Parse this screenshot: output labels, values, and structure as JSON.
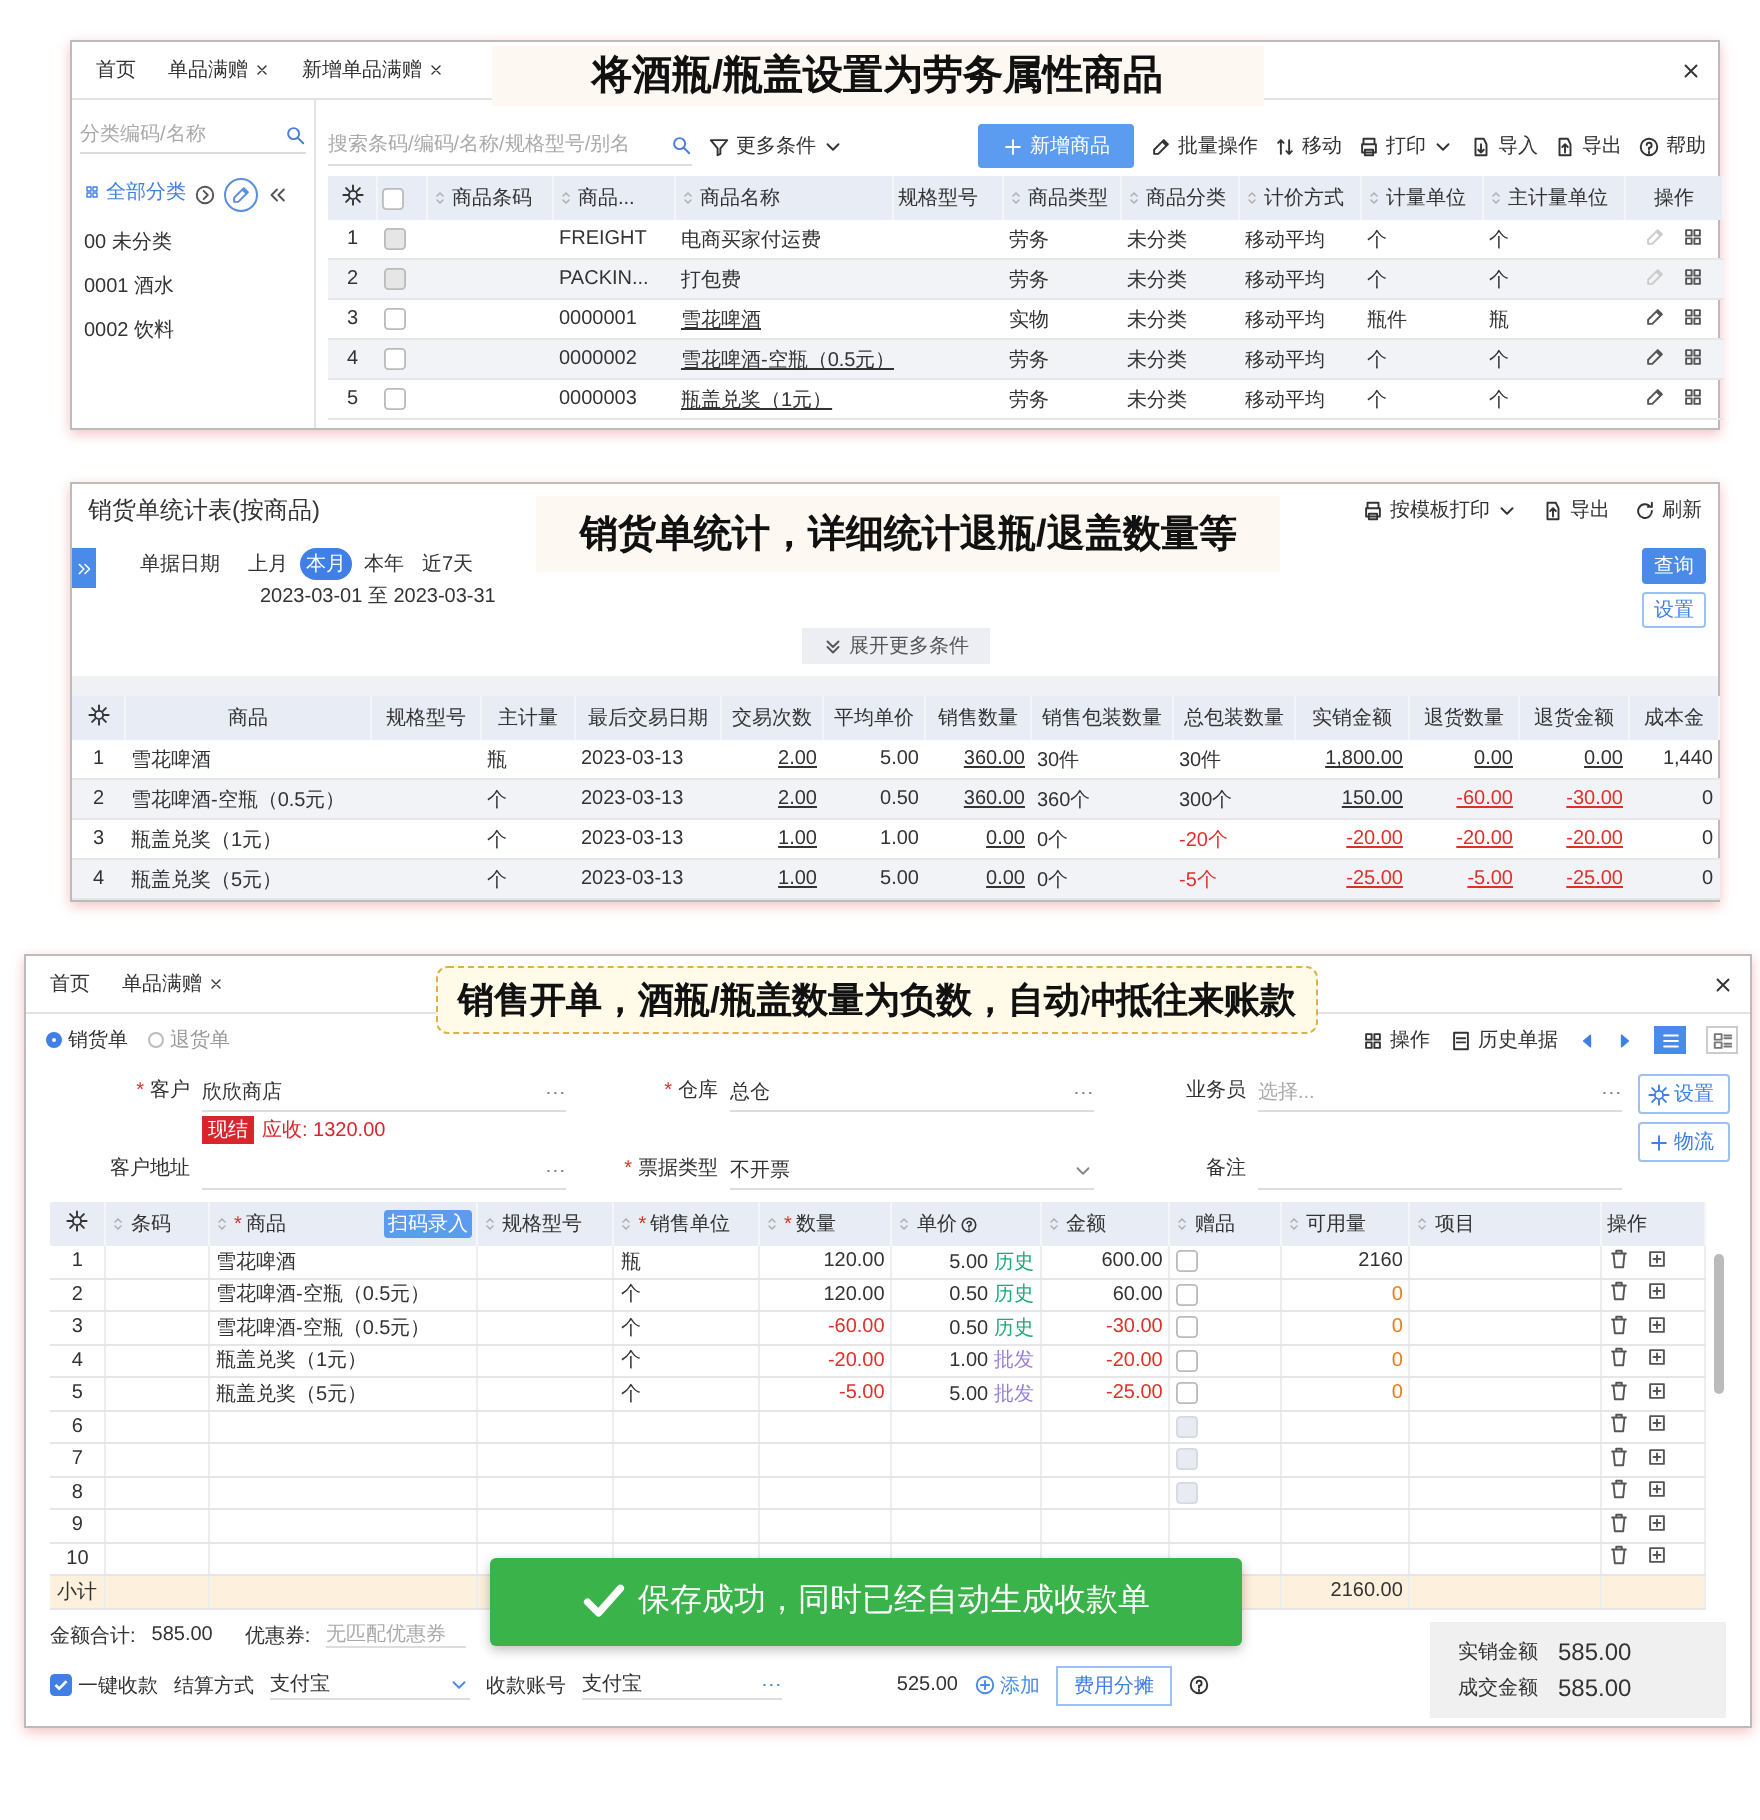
{
  "product_list": {
    "tabs": [
      {
        "label": "首页",
        "closable": false
      },
      {
        "label": "单品满赠",
        "closable": true
      },
      {
        "label": "新增单品满赠",
        "closable": true
      }
    ],
    "callout": "将酒瓶/瓶盖设置为劳务属性商品",
    "category_search": {
      "placeholder": "分类编码/名称"
    },
    "categories": [
      {
        "label": "全部分类",
        "selected": true
      },
      {
        "label": "00 未分类",
        "selected": false
      },
      {
        "label": "0001 酒水",
        "selected": false
      },
      {
        "label": "0002 饮料",
        "selected": false
      }
    ],
    "search": {
      "placeholder": "搜索条码/编码/名称/规格型号/别名"
    },
    "more_filter": "更多条件",
    "toolbar": [
      {
        "label": "新增商品",
        "kind": "primary"
      },
      {
        "label": "批量操作",
        "kind": "batch"
      },
      {
        "label": "移动",
        "kind": "move"
      },
      {
        "label": "打印",
        "kind": "print"
      },
      {
        "label": "导入",
        "kind": "import"
      },
      {
        "label": "导出",
        "kind": "export"
      },
      {
        "label": "帮助",
        "kind": "help"
      }
    ],
    "all_checked": false,
    "columns": [
      {
        "label": "商品条码",
        "sortable": true
      },
      {
        "label": "商品...",
        "sortable": true
      },
      {
        "label": "商品名称",
        "sortable": true
      },
      {
        "label": "规格型号",
        "sortable": false
      },
      {
        "label": "商品类型",
        "sortable": true
      },
      {
        "label": "商品分类",
        "sortable": true
      },
      {
        "label": "计价方式",
        "sortable": true
      },
      {
        "label": "计量单位",
        "sortable": true
      },
      {
        "label": "主计量单位",
        "sortable": true
      }
    ],
    "ops_label": "操作",
    "rows": [
      {
        "index": "1",
        "checked": false,
        "disabled": true,
        "linked": false,
        "code": "FREIGHT",
        "name": "电商买家付运费",
        "type": "劳务",
        "category": "未分类",
        "pricing": "移动平均",
        "unit": "个",
        "main_unit": "个"
      },
      {
        "index": "2",
        "checked": false,
        "disabled": true,
        "linked": false,
        "code": "PACKIN...",
        "name": "打包费",
        "type": "劳务",
        "category": "未分类",
        "pricing": "移动平均",
        "unit": "个",
        "main_unit": "个"
      },
      {
        "index": "3",
        "checked": false,
        "disabled": false,
        "linked": true,
        "code": "0000001",
        "name": "雪花啤酒",
        "type": "实物",
        "category": "未分类",
        "pricing": "移动平均",
        "unit": "瓶件",
        "main_unit": "瓶"
      },
      {
        "index": "4",
        "checked": false,
        "disabled": false,
        "linked": true,
        "code": "0000002",
        "name": "雪花啤酒-空瓶（0.5元）",
        "type": "劳务",
        "category": "未分类",
        "pricing": "移动平均",
        "unit": "个",
        "main_unit": "个"
      },
      {
        "index": "5",
        "checked": false,
        "disabled": false,
        "linked": true,
        "code": "0000003",
        "name": "瓶盖兑奖（1元）",
        "type": "劳务",
        "category": "未分类",
        "pricing": "移动平均",
        "unit": "个",
        "main_unit": "个"
      }
    ]
  },
  "sales_report": {
    "title": "销货单统计表(按商品)",
    "callout": "销货单统计，详细统计退瓶/退盖数量等",
    "actions": [
      {
        "label": "按模板打印",
        "kind": "print"
      },
      {
        "label": "导出",
        "kind": "export"
      },
      {
        "label": "刷新",
        "kind": "refresh"
      }
    ],
    "date_label": "单据日期",
    "periods": [
      {
        "label": "上月",
        "selected": false
      },
      {
        "label": "本月",
        "selected": true
      },
      {
        "label": "本年",
        "selected": false
      },
      {
        "label": "近7天",
        "selected": false
      }
    ],
    "date_range": "2023-03-01 至 2023-03-31",
    "buttons": [
      {
        "label": "查询",
        "kind": "primary"
      },
      {
        "label": "设置",
        "kind": "plain"
      }
    ],
    "expand": "展开更多条件",
    "columns": [
      "商品",
      "规格型号",
      "主计量",
      "最后交易日期",
      "交易次数",
      "平均单价",
      "销售数量",
      "销售包装数量",
      "总包装数量",
      "实销金额",
      "退货数量",
      "退货金额",
      "成本金"
    ],
    "rows": [
      {
        "index": "1",
        "cells": {
          "product": {
            "text": "雪花啤酒",
            "underlined": false,
            "negative": false
          },
          "unit": {
            "text": "瓶",
            "underlined": false,
            "negative": false
          },
          "date": {
            "text": "2023-03-13",
            "underlined": false,
            "negative": false
          },
          "count": {
            "text": "2.00",
            "underlined": true,
            "negative": false
          },
          "avg": {
            "text": "5.00",
            "underlined": false,
            "negative": false
          },
          "qty": {
            "text": "360.00",
            "underlined": true,
            "negative": false
          },
          "pack": {
            "text": "30件",
            "underlined": false,
            "negative": false
          },
          "total_pack": {
            "text": "30件",
            "underlined": false,
            "negative": false
          },
          "amount": {
            "text": "1,800.00",
            "underlined": true,
            "negative": false
          },
          "ret_qty": {
            "text": "0.00",
            "underlined": true,
            "negative": false
          },
          "ret_amount": {
            "text": "0.00",
            "underlined": true,
            "negative": false
          },
          "cost": {
            "text": "1,440",
            "underlined": false,
            "negative": false
          }
        }
      },
      {
        "index": "2",
        "cells": {
          "product": {
            "text": "雪花啤酒-空瓶（0.5元）",
            "underlined": false,
            "negative": false
          },
          "unit": {
            "text": "个",
            "underlined": false,
            "negative": false
          },
          "date": {
            "text": "2023-03-13",
            "underlined": false,
            "negative": false
          },
          "count": {
            "text": "2.00",
            "underlined": true,
            "negative": false
          },
          "avg": {
            "text": "0.50",
            "underlined": false,
            "negative": false
          },
          "qty": {
            "text": "360.00",
            "underlined": true,
            "negative": false
          },
          "pack": {
            "text": "360个",
            "underlined": false,
            "negative": false
          },
          "total_pack": {
            "text": "300个",
            "underlined": false,
            "negative": false
          },
          "amount": {
            "text": "150.00",
            "underlined": true,
            "negative": false
          },
          "ret_qty": {
            "text": "-60.00",
            "underlined": true,
            "negative": true
          },
          "ret_amount": {
            "text": "-30.00",
            "underlined": true,
            "negative": true
          },
          "cost": {
            "text": "0",
            "underlined": false,
            "negative": false
          }
        }
      },
      {
        "index": "3",
        "cells": {
          "product": {
            "text": "瓶盖兑奖（1元）",
            "underlined": false,
            "negative": false
          },
          "unit": {
            "text": "个",
            "underlined": false,
            "negative": false
          },
          "date": {
            "text": "2023-03-13",
            "underlined": false,
            "negative": false
          },
          "count": {
            "text": "1.00",
            "underlined": true,
            "negative": false
          },
          "avg": {
            "text": "1.00",
            "underlined": false,
            "negative": false
          },
          "qty": {
            "text": "0.00",
            "underlined": true,
            "negative": false
          },
          "pack": {
            "text": "0个",
            "underlined": false,
            "negative": false
          },
          "total_pack": {
            "text": "-20个",
            "underlined": false,
            "negative": true
          },
          "amount": {
            "text": "-20.00",
            "underlined": true,
            "negative": true
          },
          "ret_qty": {
            "text": "-20.00",
            "underlined": true,
            "negative": true
          },
          "ret_amount": {
            "text": "-20.00",
            "underlined": true,
            "negative": true
          },
          "cost": {
            "text": "0",
            "underlined": false,
            "negative": false
          }
        }
      },
      {
        "index": "4",
        "cells": {
          "product": {
            "text": "瓶盖兑奖（5元）",
            "underlined": false,
            "negative": false
          },
          "unit": {
            "text": "个",
            "underlined": false,
            "negative": false
          },
          "date": {
            "text": "2023-03-13",
            "underlined": false,
            "negative": false
          },
          "count": {
            "text": "1.00",
            "underlined": true,
            "negative": false
          },
          "avg": {
            "text": "5.00",
            "underlined": false,
            "negative": false
          },
          "qty": {
            "text": "0.00",
            "underlined": true,
            "negative": false
          },
          "pack": {
            "text": "0个",
            "underlined": false,
            "negative": false
          },
          "total_pack": {
            "text": "-5个",
            "underlined": false,
            "negative": true
          },
          "amount": {
            "text": "-25.00",
            "underlined": true,
            "negative": true
          },
          "ret_qty": {
            "text": "-5.00",
            "underlined": true,
            "negative": true
          },
          "ret_amount": {
            "text": "-25.00",
            "underlined": true,
            "negative": true
          },
          "cost": {
            "text": "0",
            "underlined": false,
            "negative": false
          }
        }
      }
    ]
  },
  "sales_order": {
    "tabs": [
      {
        "label": "首页",
        "closable": false
      },
      {
        "label": "单品满赠",
        "closable": true
      }
    ],
    "callout": "销售开单，酒瓶/瓶盖数量为负数，自动冲抵往来账款",
    "doc_types": [
      {
        "label": "销货单",
        "selected": true
      },
      {
        "label": "退货单",
        "selected": false
      }
    ],
    "toolbar": [
      {
        "label": "操作",
        "kind": "ops"
      },
      {
        "label": "历史单据",
        "kind": "history"
      }
    ],
    "views": [
      {
        "kind": "list",
        "selected": true
      },
      {
        "kind": "card",
        "selected": false
      }
    ],
    "required_mark": "*",
    "fields": [
      {
        "label": "客户",
        "required": true,
        "value": "欣欣商店",
        "kind": "picker"
      },
      {
        "label": "仓库",
        "required": true,
        "value": "总仓",
        "kind": "picker"
      },
      {
        "label": "业务员",
        "required": false,
        "placeholder": "选择...",
        "kind": "picker"
      },
      {
        "label": "客户地址",
        "required": false,
        "kind": "picker"
      },
      {
        "label": "票据类型",
        "required": true,
        "value": "不开票",
        "kind": "select"
      },
      {
        "label": "备注",
        "required": false,
        "kind": "text"
      }
    ],
    "customer_tag": "现结",
    "customer_balance": "应收: 1320.00",
    "side_buttons": [
      {
        "label": "设置",
        "kind": "settings"
      },
      {
        "label": "物流",
        "kind": "add"
      }
    ],
    "columns": [
      {
        "label": "条码",
        "required": false,
        "sortable": true,
        "help": false
      },
      {
        "label": "商品",
        "required": true,
        "sortable": true,
        "help": false,
        "badge": "扫码录入"
      },
      {
        "label": "规格型号",
        "required": false,
        "sortable": true,
        "help": false
      },
      {
        "label": "销售单位",
        "required": true,
        "sortable": true,
        "help": false
      },
      {
        "label": "数量",
        "required": true,
        "sortable": true,
        "help": false
      },
      {
        "label": "单价",
        "required": false,
        "sortable": true,
        "help": true
      },
      {
        "label": "金额",
        "required": false,
        "sortable": true,
        "help": false
      },
      {
        "label": "赠品",
        "required": false,
        "sortable": true,
        "help": false
      },
      {
        "label": "可用量",
        "required": false,
        "sortable": true,
        "help": false
      },
      {
        "label": "项目",
        "required": false,
        "sortable": true,
        "help": false
      },
      {
        "label": "操作",
        "required": false,
        "sortable": false,
        "help": false
      }
    ],
    "rows": [
      {
        "index": "1",
        "product": "雪花啤酒",
        "unit": "瓶",
        "qty": {
          "text": "120.00",
          "negative": false
        },
        "price": "5.00",
        "price_tag": {
          "text": "历史",
          "kind": "history"
        },
        "amount": {
          "text": "600.00",
          "negative": false
        },
        "gift": {
          "checked": false,
          "disabled": false
        },
        "available": {
          "text": "2160",
          "warning": false
        }
      },
      {
        "index": "2",
        "product": "雪花啤酒-空瓶（0.5元）",
        "unit": "个",
        "qty": {
          "text": "120.00",
          "negative": false
        },
        "price": "0.50",
        "price_tag": {
          "text": "历史",
          "kind": "history"
        },
        "amount": {
          "text": "60.00",
          "negative": false
        },
        "gift": {
          "checked": false,
          "disabled": false
        },
        "available": {
          "text": "0",
          "warning": true
        }
      },
      {
        "index": "3",
        "product": "雪花啤酒-空瓶（0.5元）",
        "unit": "个",
        "qty": {
          "text": "-60.00",
          "negative": true
        },
        "price": "0.50",
        "price_tag": {
          "text": "历史",
          "kind": "history"
        },
        "amount": {
          "text": "-30.00",
          "negative": true
        },
        "gift": {
          "checked": false,
          "disabled": false
        },
        "available": {
          "text": "0",
          "warning": true
        }
      },
      {
        "index": "4",
        "product": "瓶盖兑奖（1元）",
        "unit": "个",
        "qty": {
          "text": "-20.00",
          "negative": true
        },
        "price": "1.00",
        "price_tag": {
          "text": "批发",
          "kind": "wholesale"
        },
        "amount": {
          "text": "-20.00",
          "negative": true
        },
        "gift": {
          "checked": false,
          "disabled": false
        },
        "available": {
          "text": "0",
          "warning": true
        }
      },
      {
        "index": "5",
        "product": "瓶盖兑奖（5元）",
        "unit": "个",
        "qty": {
          "text": "-5.00",
          "negative": true
        },
        "price": "5.00",
        "price_tag": {
          "text": "批发",
          "kind": "wholesale"
        },
        "amount": {
          "text": "-25.00",
          "negative": true
        },
        "gift": {
          "checked": false,
          "disabled": false
        },
        "available": {
          "text": "0",
          "warning": true
        }
      },
      {
        "index": "6",
        "gift": {
          "checked": false,
          "disabled": true
        }
      },
      {
        "index": "7",
        "gift": {
          "checked": false,
          "disabled": true
        }
      },
      {
        "index": "8",
        "gift": {
          "checked": false,
          "disabled": true
        }
      },
      {
        "index": "9"
      },
      {
        "index": "10"
      }
    ],
    "subtotal_label": "小计",
    "subtotal_available": "2160.00",
    "total_label": "金额合计:",
    "total": "585.00",
    "coupon_label": "优惠券:",
    "coupon_placeholder": "无匹配优惠券",
    "one_click": {
      "label": "一键收款",
      "checked": true
    },
    "settle_label": "结算方式",
    "settle_value": "支付宝",
    "account_label": "收款账号",
    "account_value": "支付宝",
    "pay_amount": "525.00",
    "add_label": "添加",
    "split_button": "费用分摊",
    "summary": [
      {
        "label": "实销金额",
        "value": "585.00"
      },
      {
        "label": "成交金额",
        "value": "585.00"
      }
    ]
  },
  "toast": "保存成功，同时已经自动生成收款单"
}
